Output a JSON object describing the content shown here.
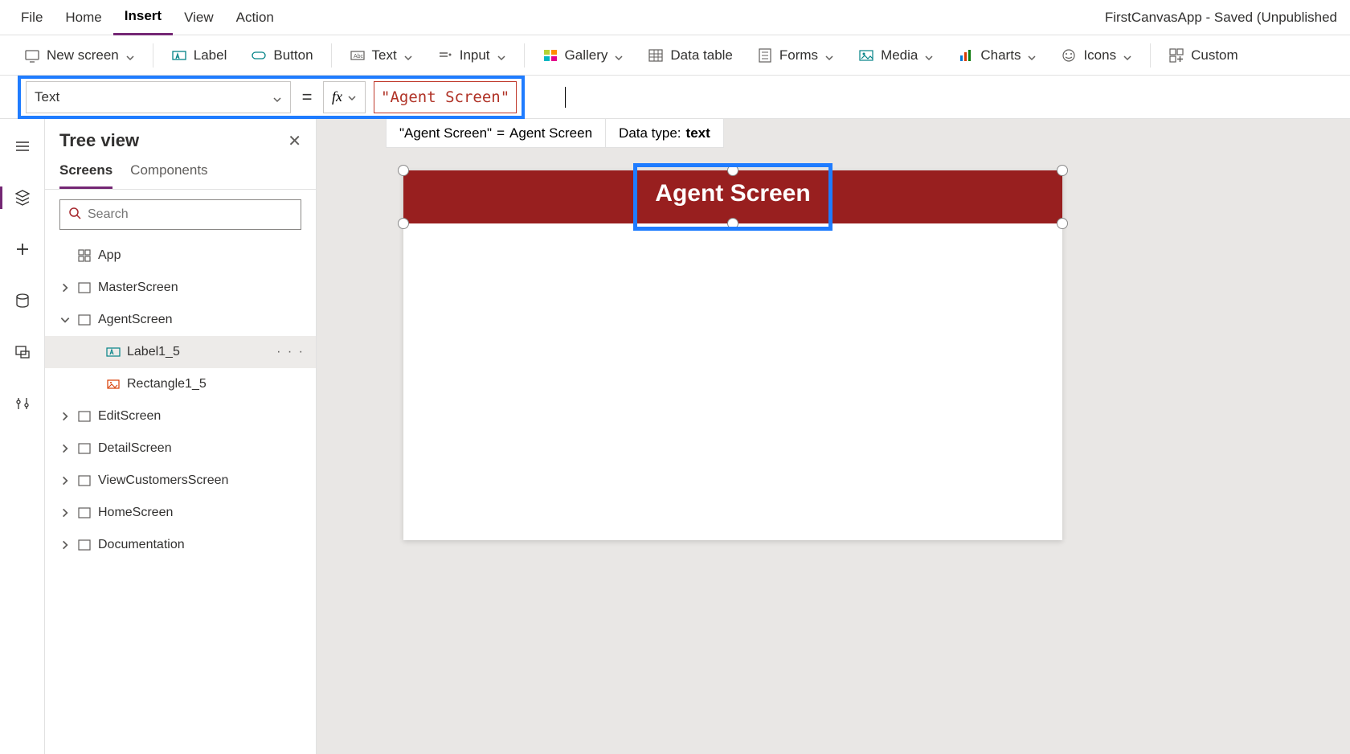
{
  "menu": {
    "items": [
      "File",
      "Home",
      "Insert",
      "View",
      "Action"
    ],
    "active": "Insert"
  },
  "app_title": "FirstCanvasApp - Saved (Unpublished",
  "ribbon": {
    "new_screen": "New screen",
    "label": "Label",
    "button": "Button",
    "text": "Text",
    "input": "Input",
    "gallery": "Gallery",
    "data_table": "Data table",
    "forms": "Forms",
    "media": "Media",
    "charts": "Charts",
    "icons": "Icons",
    "custom": "Custom"
  },
  "formula_bar": {
    "property": "Text",
    "equals": "=",
    "fx": "fx",
    "value": "\"Agent Screen\""
  },
  "info_strip": {
    "eval_left": "\"Agent Screen\"",
    "eval_eq": "=",
    "eval_right": "Agent Screen",
    "datatype_label": "Data type:",
    "datatype_value": "text"
  },
  "tree_view": {
    "title": "Tree view",
    "tabs": {
      "screens": "Screens",
      "components": "Components"
    },
    "search_placeholder": "Search",
    "app_root": "App",
    "nodes": [
      {
        "label": "MasterScreen",
        "expandable": true,
        "expanded": false,
        "depth": 1,
        "icon": "screen"
      },
      {
        "label": "AgentScreen",
        "expandable": true,
        "expanded": true,
        "depth": 1,
        "icon": "screen"
      },
      {
        "label": "Label1_5",
        "expandable": false,
        "expanded": false,
        "depth": 2,
        "icon": "label",
        "selected": true
      },
      {
        "label": "Rectangle1_5",
        "expandable": false,
        "expanded": false,
        "depth": 2,
        "icon": "rect"
      },
      {
        "label": "EditScreen",
        "expandable": true,
        "expanded": false,
        "depth": 1,
        "icon": "screen"
      },
      {
        "label": "DetailScreen",
        "expandable": true,
        "expanded": false,
        "depth": 1,
        "icon": "screen"
      },
      {
        "label": "ViewCustomersScreen",
        "expandable": true,
        "expanded": false,
        "depth": 1,
        "icon": "screen"
      },
      {
        "label": "HomeScreen",
        "expandable": true,
        "expanded": false,
        "depth": 1,
        "icon": "screen"
      },
      {
        "label": "Documentation",
        "expandable": true,
        "expanded": false,
        "depth": 1,
        "icon": "screen"
      }
    ]
  },
  "canvas": {
    "header_label": "Agent Screen",
    "header_bg": "#981f1f"
  }
}
